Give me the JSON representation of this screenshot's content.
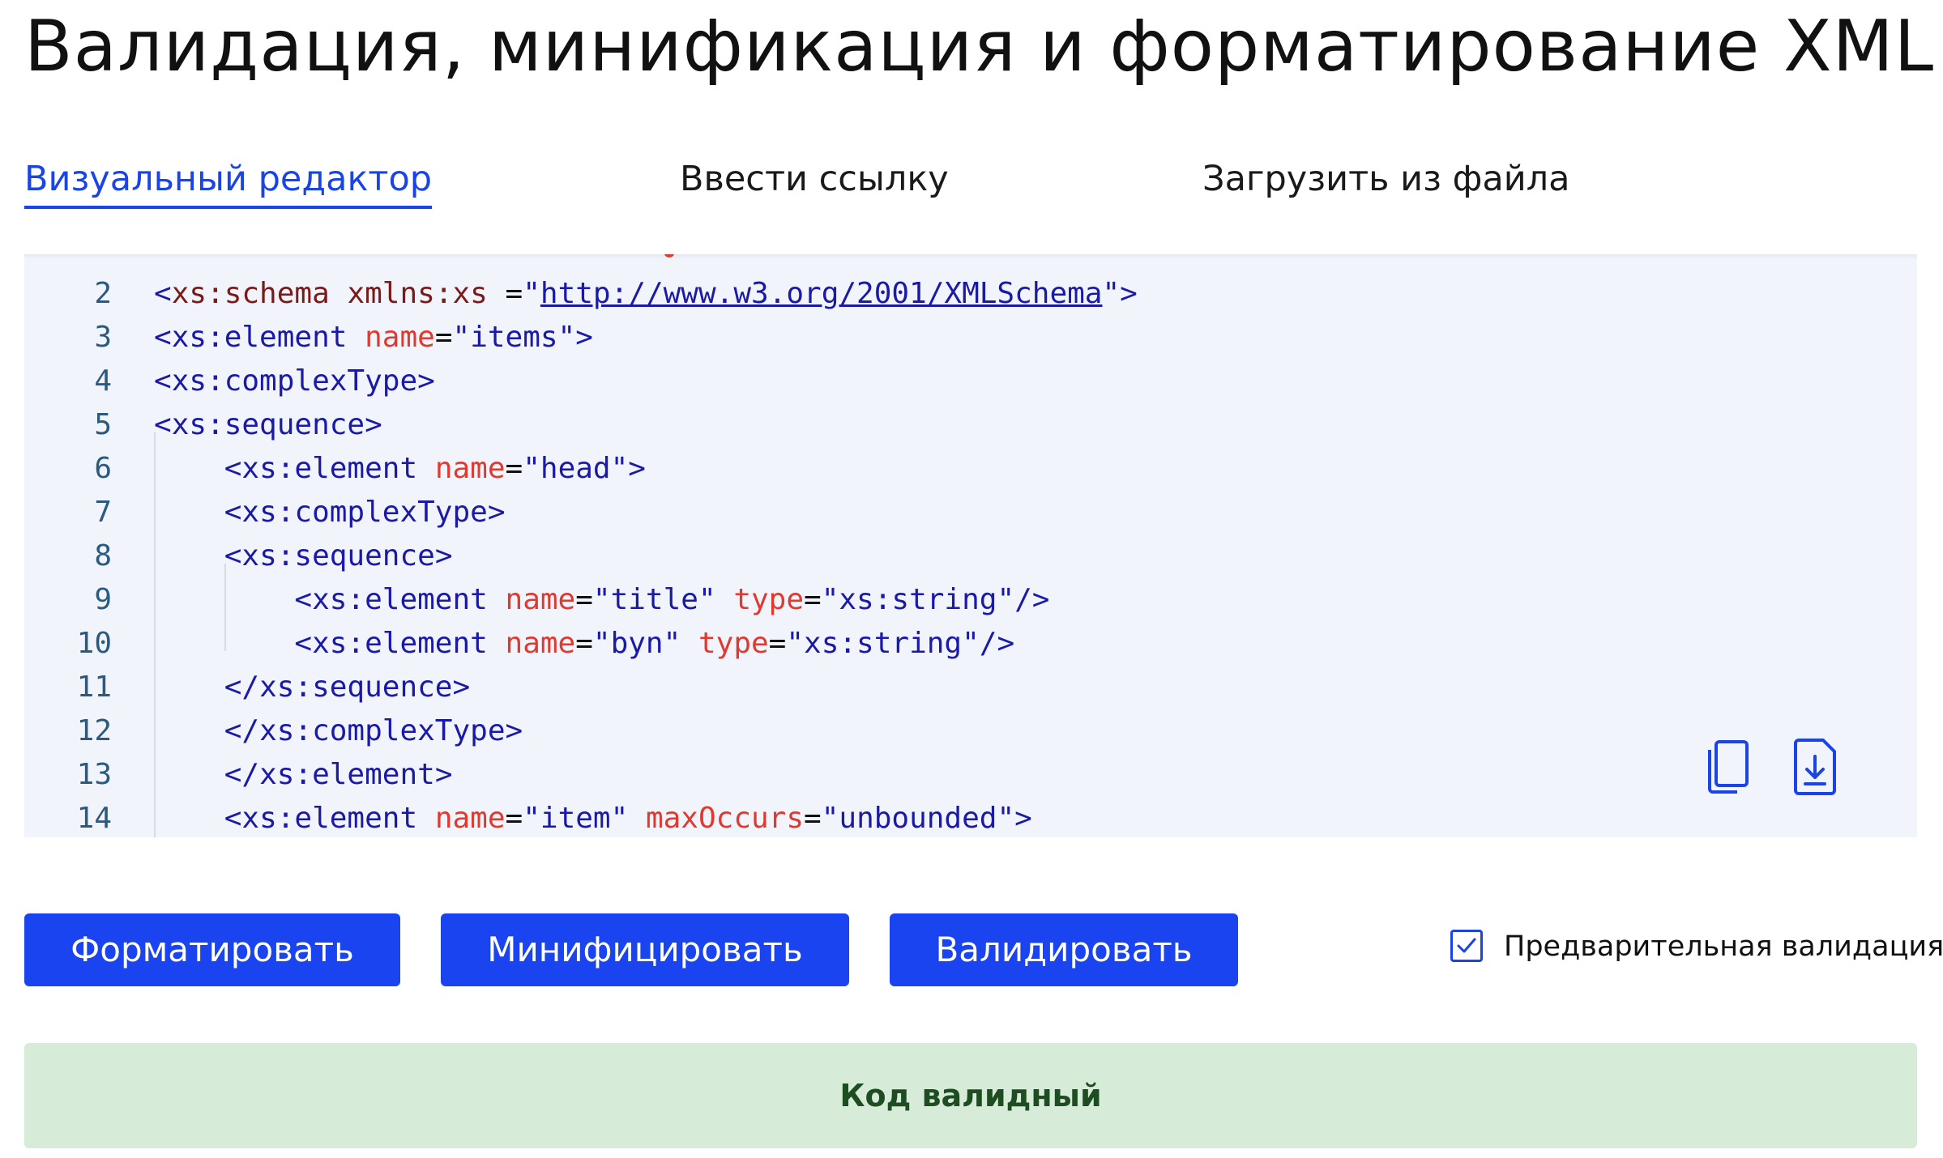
{
  "page": {
    "title": "Валидация, минификация и форматирование XML"
  },
  "tabs": [
    {
      "label": "Визуальный редактор",
      "active": true
    },
    {
      "label": "Ввести ссылку",
      "active": false
    },
    {
      "label": "Загрузить из файла",
      "active": false
    }
  ],
  "editor": {
    "lines": [
      {
        "number": "2",
        "code": "<xs:schema xmlns:xs =\"http://www.w3.org/2001/XMLSchema\">"
      },
      {
        "number": "3",
        "code": "<xs:element name=\"items\">"
      },
      {
        "number": "4",
        "code": "<xs:complexType>"
      },
      {
        "number": "5",
        "code": "<xs:sequence>"
      },
      {
        "number": "6",
        "code": "    <xs:element name=\"head\">"
      },
      {
        "number": "7",
        "code": "    <xs:complexType>"
      },
      {
        "number": "8",
        "code": "    <xs:sequence>"
      },
      {
        "number": "9",
        "code": "        <xs:element name=\"title\" type=\"xs:string\"/>"
      },
      {
        "number": "10",
        "code": "        <xs:element name=\"byn\" type=\"xs:string\"/>"
      },
      {
        "number": "11",
        "code": "    </xs:sequence>"
      },
      {
        "number": "12",
        "code": "    </xs:complexType>"
      },
      {
        "number": "13",
        "code": "    </xs:element>"
      },
      {
        "number": "14",
        "code": "    <xs:element name=\"item\" maxOccurs=\"unbounded\">"
      }
    ],
    "tools": {
      "copy_icon": "copy-icon",
      "download_icon": "download-icon"
    }
  },
  "actions": {
    "format_label": "Форматировать",
    "minify_label": "Минифицировать",
    "validate_label": "Валидировать",
    "prevalidation_label": "Предварительная валидация",
    "prevalidation_checked": true
  },
  "result": {
    "message": "Код валидный"
  },
  "colors": {
    "accent": "#1a44f0",
    "tag": "#1a1aa6",
    "attribute": "#e0392f",
    "editor_bg": "#f1f4fb",
    "success_bg": "#d7ebd9",
    "success_text": "#1e4d22"
  }
}
